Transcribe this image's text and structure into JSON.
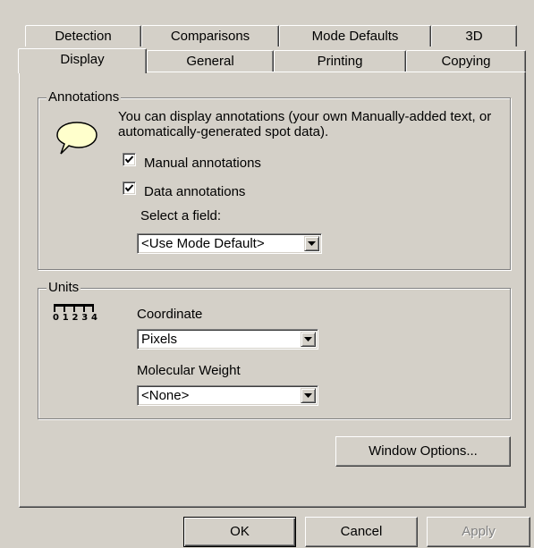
{
  "tabs_back": [
    "Detection",
    "Comparisons",
    "Mode Defaults",
    "3D"
  ],
  "tabs_front": [
    "Display",
    "General",
    "Printing",
    "Copying"
  ],
  "annotations": {
    "title": "Annotations",
    "description": "You can display annotations (your own Manually-added text, or automatically-generated spot data).",
    "manual_label": "Manual annotations",
    "manual_checked": true,
    "data_label": "Data annotations",
    "data_checked": true,
    "field_label": "Select a field:",
    "field_value": "<Use Mode Default>",
    "icon": "speech-bubble-icon"
  },
  "units": {
    "title": "Units",
    "ruler_digits": "01234",
    "icon": "ruler-icon",
    "coordinate_label": "Coordinate",
    "coordinate_value": "Pixels",
    "mw_label": "Molecular Weight",
    "mw_value": "<None>"
  },
  "window_options_label": "Window Options...",
  "buttons": {
    "ok": "OK",
    "cancel": "Cancel",
    "apply": "Apply"
  },
  "colors": {
    "face": "#d4d0c8",
    "highlight": "#ffffff",
    "shadow": "#808080",
    "dark_shadow": "#404040",
    "bubble": "#ffffcc"
  }
}
